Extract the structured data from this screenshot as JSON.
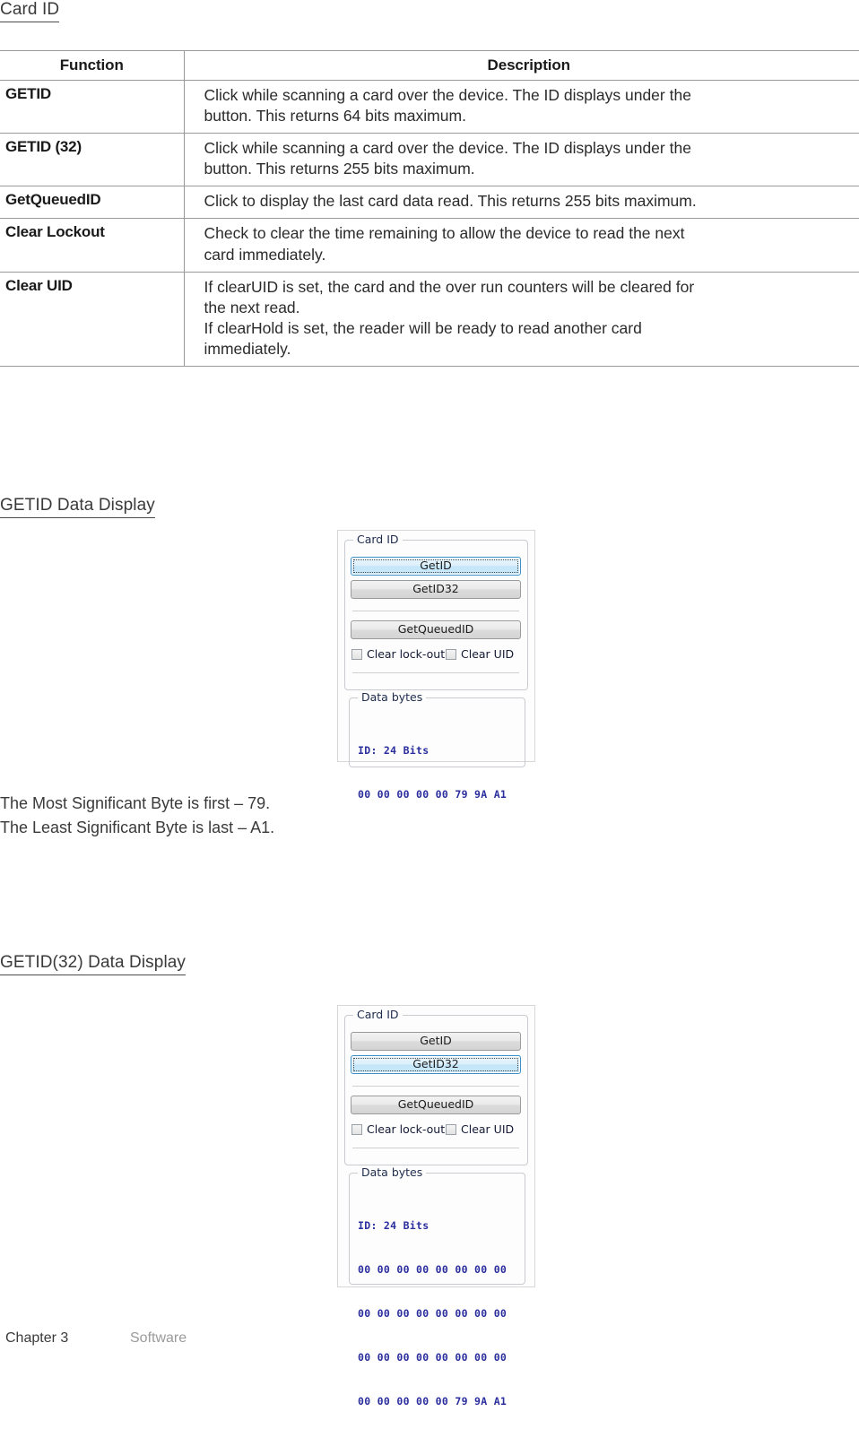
{
  "page": {
    "heading_card_id": "Card ID",
    "heading_getid_display": "GETID Data Display",
    "heading_getid32_display": "GETID(32) Data Display"
  },
  "table": {
    "headers": {
      "function": "Function",
      "description": "Description"
    },
    "rows": [
      {
        "function": "GETID",
        "description_lines": [
          "Click while scanning a card over the device. The ID displays under the",
          "button. This returns 64 bits maximum."
        ]
      },
      {
        "function": "GETID (32)",
        "description_lines": [
          "Click while scanning a card over the device. The ID displays under the",
          "button. This returns 255 bits maximum."
        ]
      },
      {
        "function": "GetQueuedID",
        "description_lines": [
          "Click to display the last card data read. This returns 255 bits maximum."
        ]
      },
      {
        "function": "Clear Lockout",
        "description_lines": [
          "Check to clear the time remaining to allow the device to read the next",
          "card immediately."
        ]
      },
      {
        "function": "Clear UID",
        "description_lines": [
          "If clearUID is set, the card and the over run counters will be cleared for",
          "the next read.",
          "If clearHold is set, the reader will be ready to read another card",
          "immediately."
        ]
      }
    ]
  },
  "note": {
    "lines": [
      "The Most Significant Byte is first – 79.",
      "The Least Significant Byte is last – A1."
    ]
  },
  "screenshot_getid": {
    "groupbox_card_id_label": "Card ID",
    "groupbox_data_bytes_label": "Data bytes",
    "buttons": {
      "getid": "GetID",
      "getid32": "GetID32",
      "getqueuedid": "GetQueuedID"
    },
    "focused_button": "GetID",
    "checkboxes": {
      "clear_lockout": "Clear lock-out",
      "clear_uid": "Clear UID"
    },
    "data_bytes_lines": [
      "ID: 24 Bits",
      "00 00 00 00 00 79 9A A1"
    ]
  },
  "screenshot_getid32": {
    "groupbox_card_id_label": "Card ID",
    "groupbox_data_bytes_label": "Data bytes",
    "buttons": {
      "getid": "GetID",
      "getid32": "GetID32",
      "getqueuedid": "GetQueuedID"
    },
    "focused_button": "GetID32",
    "checkboxes": {
      "clear_lockout": "Clear lock-out",
      "clear_uid": "Clear UID"
    },
    "data_bytes_lines": [
      "ID: 24 Bits",
      "00 00 00 00 00 00 00 00",
      "00 00 00 00 00 00 00 00",
      "00 00 00 00 00 00 00 00",
      "00 00 00 00 00 79 9A A1"
    ]
  },
  "footer": {
    "chapter": "Chapter 3",
    "section": "Software"
  },
  "colors": {
    "focus_border": "#3c90c8",
    "data_text": "#2b2f9e",
    "table_border": "#9a9a9a",
    "footer_muted": "#9b9b9b"
  }
}
